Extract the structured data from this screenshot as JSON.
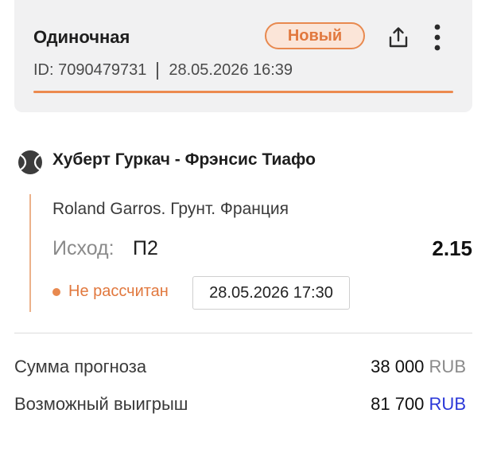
{
  "header": {
    "bet_type": "Одиночная",
    "status_badge": "Новый",
    "id_text": "ID: 7090479731",
    "datetime": "28.05.2026 16:39",
    "share_icon": "share-icon",
    "more_icon": "more-vertical-icon",
    "accent_color": "#ec8a4f"
  },
  "event": {
    "sport_icon": "tennis-ball-icon",
    "title": "Хуберт Гуркач - Фрэнсис Тиафо",
    "tournament": "Roland Garros. Грунт. Франция",
    "outcome_label": "Исход:",
    "outcome_value": "П2",
    "odds": "2.15",
    "status": "Не рассчитан",
    "event_datetime": "28.05.2026 17:30"
  },
  "summary": {
    "stake_label": "Сумма прогноза",
    "stake_amount": "38 000",
    "stake_currency": "RUB",
    "win_label": "Возможный выигрыш",
    "win_amount": "81 700",
    "win_currency": "RUB"
  }
}
